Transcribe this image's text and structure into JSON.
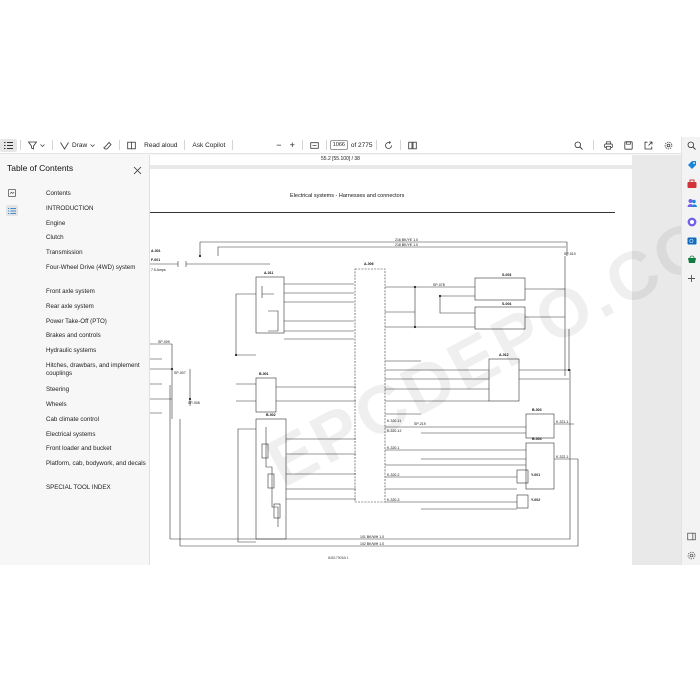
{
  "toolbar": {
    "draw_label": "Draw",
    "read_aloud_label": "Read aloud",
    "ask_copilot_label": "Ask Copilot",
    "zoom_out": "−",
    "zoom_in": "+",
    "page_number": "1066",
    "page_total": "of 2775"
  },
  "toc": {
    "title": "Table of Contents",
    "items": [
      "Contents",
      "INTRODUCTION",
      "Engine",
      "Clutch",
      "Transmission",
      "Four-Wheel Drive (4WD) system",
      "Front axle system",
      "Rear axle system",
      "Power Take-Off (PTO)",
      "Brakes and controls",
      "Hydraulic systems",
      "Hitches, drawbars, and implement couplings",
      "Steering",
      "Wheels",
      "Cab climate control",
      "Electrical systems",
      "Front loader and bucket",
      "Platform, cab, bodywork, and decals",
      "SPECIAL TOOL INDEX"
    ]
  },
  "document": {
    "prev_page_ref": "55.2 [55.100] / 38",
    "page_title": "Electrical systems - Harnesses and connectors",
    "watermark": "EPCDEPO.COM",
    "footer": "84517905A 1",
    "labels": {
      "a_001": "A-001",
      "a_006": "A-006",
      "a_011": "A-011",
      "a_012": "A-012",
      "b_001": "B-001",
      "b_002": "B-002",
      "s_003": "S-003",
      "s_004": "S-004",
      "b_003": "B-003",
      "b_004": "B-004",
      "y_001": "Y-001",
      "y_002": "Y-002",
      "f_001": "F-001",
      "sp_009": "SP-009",
      "sp_007": "SP-007",
      "sp_008": "SP-008",
      "sp_010": "SP-010",
      "sp_078": "SP-078",
      "sp_219": "SP-219",
      "fuse_rating": "7.5 Amps",
      "wire_top1": "216 BK/YE 1.0",
      "wire_top2": "218 BK/YE 1.0",
      "wire_bottom1": "101 BK/WH 1.0",
      "wire_bottom2": "102 BK/WH 1.0",
      "k320_11": "K-320-11",
      "k320_12": "K-320-12",
      "k320_1": "K-320-1",
      "k320_2": "K-320-2",
      "k320_3": "K-320-3",
      "k321_1": "K-321-1",
      "k322_1": "K-322-1"
    }
  },
  "colors": {
    "accent": "#0f6cbd",
    "rail_red": "#d13438",
    "rail_purple": "#7160e8",
    "rail_blue": "#1a86d9",
    "rail_green": "#107c41"
  },
  "icons": {
    "toc": "list-icon",
    "filter": "filter-icon",
    "draw": "pen-icon",
    "erase": "eraser-icon",
    "read_aloud": "book-icon",
    "fit": "fit-page-icon",
    "rotate": "rotate-icon",
    "spread": "two-page-icon",
    "search": "search-icon",
    "print": "print-icon",
    "save": "save-icon",
    "share": "share-icon",
    "settings": "gear-icon"
  }
}
